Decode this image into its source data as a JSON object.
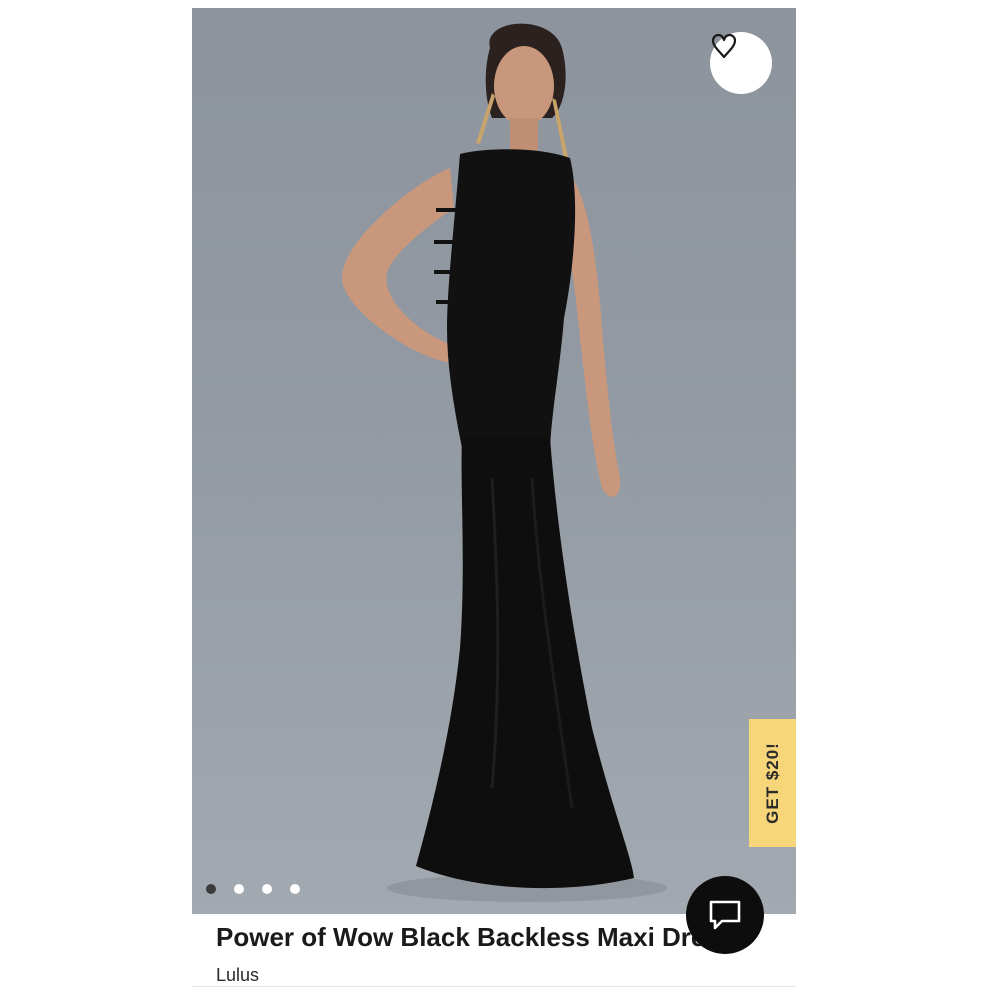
{
  "product": {
    "title": "Power of Wow Black Backless Maxi Dress",
    "brand": "Lulus",
    "image_alt": "Model wearing black backless maxi dress"
  },
  "carousel": {
    "total_slides": 4,
    "active_index": 0
  },
  "promo": {
    "label": "GET $20!",
    "color": "#f7d67a"
  },
  "icons": {
    "favorite": "heart-icon",
    "chat": "chat-bubble-icon"
  }
}
